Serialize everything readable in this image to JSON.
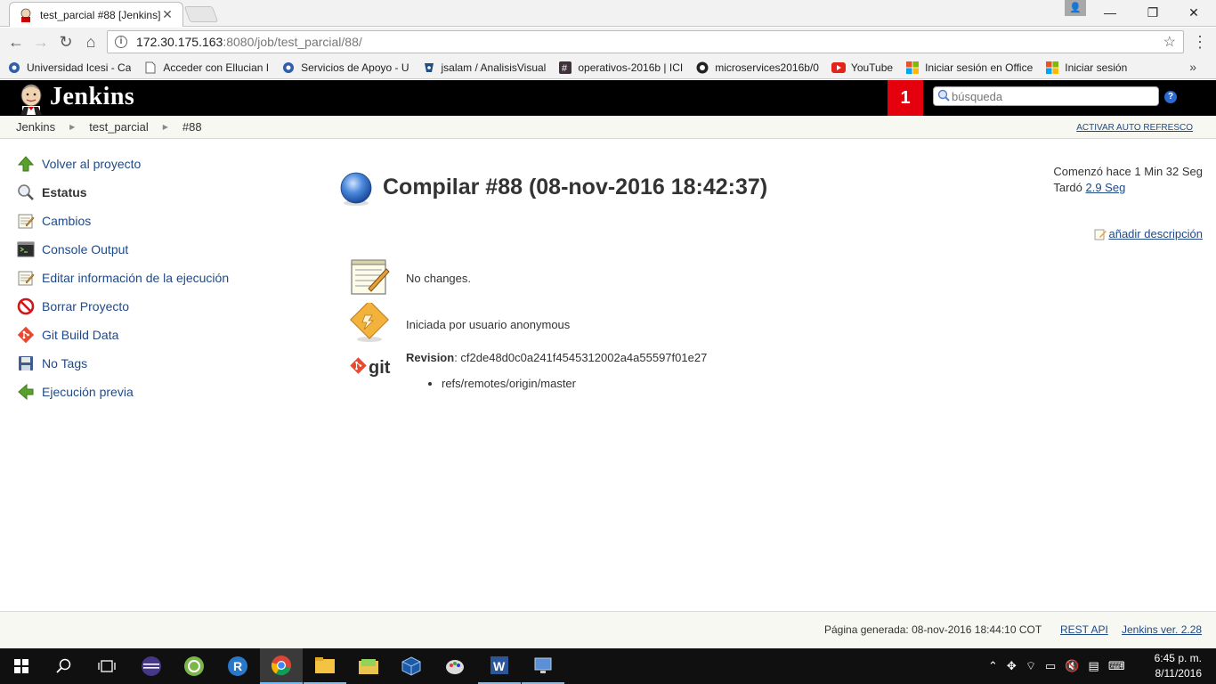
{
  "browser": {
    "tab_title": "test_parcial #88 [Jenkins]",
    "url_host": "172.30.175.163",
    "url_rest": ":8080/job/test_parcial/88/",
    "bookmarks": [
      {
        "label": "Universidad Icesi - Ca",
        "icon": "gear-blue-icon"
      },
      {
        "label": "Acceder con Ellucian I",
        "icon": "page-icon"
      },
      {
        "label": "Servicios de Apoyo - U",
        "icon": "gear-blue-icon"
      },
      {
        "label": "jsalam / AnalisisVisual",
        "icon": "bitbucket-icon"
      },
      {
        "label": "operativos-2016b | ICI",
        "icon": "slack-icon"
      },
      {
        "label": "microservices2016b/0",
        "icon": "github-icon"
      },
      {
        "label": "YouTube",
        "icon": "youtube-icon"
      },
      {
        "label": "Iniciar sesión en Office",
        "icon": "microsoft-icon"
      },
      {
        "label": "Iniciar sesión",
        "icon": "microsoft-icon"
      }
    ],
    "bookmarks_more": "»"
  },
  "jenkins": {
    "title": "Jenkins",
    "notification_count": "1",
    "search_placeholder": "búsqueda",
    "help_label": "?",
    "breadcrumbs": [
      "Jenkins",
      "test_parcial",
      "#88"
    ],
    "auto_refresh": "ACTIVAR AUTO REFRESCO"
  },
  "side_tasks": [
    {
      "label": "Volver al proyecto",
      "icon": "up-arrow-icon"
    },
    {
      "label": "Estatus",
      "icon": "search-icon"
    },
    {
      "label": "Cambios",
      "icon": "notepad-icon"
    },
    {
      "label": "Console Output",
      "icon": "terminal-icon"
    },
    {
      "label": "Editar información de la ejecución",
      "icon": "notepad-icon"
    },
    {
      "label": "Borrar Proyecto",
      "icon": "no-entry-icon"
    },
    {
      "label": "Git Build Data",
      "icon": "git-icon"
    },
    {
      "label": "No Tags",
      "icon": "save-icon"
    },
    {
      "label": "Ejecución previa",
      "icon": "left-arrow-icon"
    }
  ],
  "build": {
    "title": "Compilar #88 (08-nov-2016 18:42:37)",
    "started_label": "Comenzó hace 1 Min 32 Seg",
    "took_label": "Tardó",
    "duration": "2.9 Seg",
    "add_description": "añadir descripción",
    "changes_text": "No changes.",
    "cause_text": "Iniciada por usuario anonymous",
    "revision_label": "Revision",
    "revision_value": ": cf2de48d0c0a241f4545312002a4a55597f01e27",
    "branch": "refs/remotes/origin/master",
    "git_text": "git"
  },
  "footer": {
    "generated": "Página generada: 08-nov-2016 18:44:10 COT",
    "rest_api": "REST API",
    "version": "Jenkins ver. 2.28"
  },
  "taskbar": {
    "time": "6:45 p. m.",
    "date": "8/11/2016"
  },
  "colors": {
    "link": "#204a87",
    "jenkins_header": "#000000",
    "badge": "#e4000c",
    "status_ball": "#3d7bd1"
  }
}
